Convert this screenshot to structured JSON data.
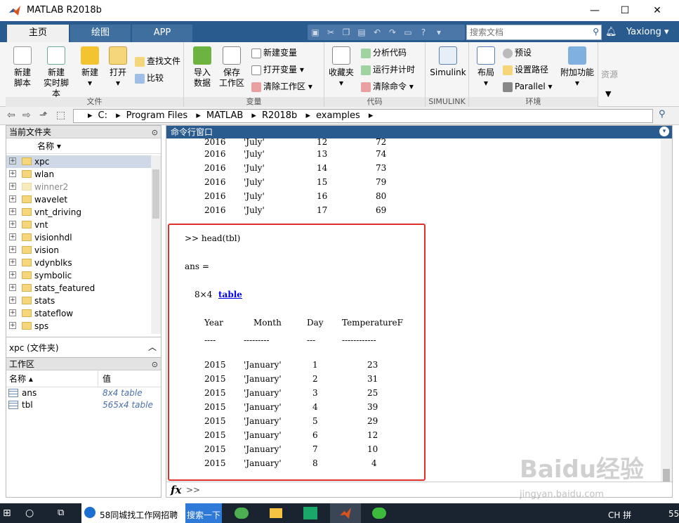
{
  "window": {
    "title": "MATLAB R2018b",
    "minimize": "—",
    "maximize": "☐",
    "close": "✕"
  },
  "tabs": [
    {
      "label": "主页"
    },
    {
      "label": "绘图"
    },
    {
      "label": "APP"
    }
  ],
  "search": {
    "placeholder": "搜索文档"
  },
  "user": {
    "name": "Yaxiong ▾"
  },
  "ribbon": {
    "file": {
      "group": "文件",
      "new_script": "新建\n脚本",
      "new_live": "新建\n实时脚本",
      "new": "新建",
      "open": "打开",
      "find_files": "查找文件",
      "compare": "比较"
    },
    "variable": {
      "group": "变量",
      "import": "导入\n数据",
      "save_ws": "保存\n工作区",
      "new_var": "新建变量",
      "open_var": "打开变量 ▾",
      "clear_ws": "清除工作区 ▾"
    },
    "code": {
      "group": "代码",
      "favorites": "收藏夹",
      "analyze": "分析代码",
      "run_time": "运行并计时",
      "clear_cmd": "清除命令 ▾"
    },
    "simulink": {
      "group": "SIMULINK",
      "simulink": "Simulink"
    },
    "env": {
      "group": "环境",
      "layout": "布局",
      "prefs": "预设",
      "set_path": "设置路径",
      "parallel": "Parallel ▾",
      "addons": "附加功能"
    },
    "resources": {
      "label": "资源"
    }
  },
  "path": {
    "segments": [
      "C:",
      "Program Files",
      "MATLAB",
      "R2018b",
      "examples"
    ]
  },
  "current_folder": {
    "title": "当前文件夹",
    "col_name": "名称 ▾",
    "items": [
      {
        "name": "xpc"
      },
      {
        "name": "wlan"
      },
      {
        "name": "winner2"
      },
      {
        "name": "wavelet"
      },
      {
        "name": "vnt_driving"
      },
      {
        "name": "vnt"
      },
      {
        "name": "visionhdl"
      },
      {
        "name": "vision"
      },
      {
        "name": "vdynblks"
      },
      {
        "name": "symbolic"
      },
      {
        "name": "stats_featured"
      },
      {
        "name": "stats"
      },
      {
        "name": "stateflow"
      },
      {
        "name": "sps"
      }
    ],
    "details": "xpc  (文件夹)"
  },
  "workspace": {
    "title": "工作区",
    "col_name": "名称 ▴",
    "col_value": "值",
    "vars": [
      {
        "name": "ans",
        "value": "8x4 table"
      },
      {
        "name": "tbl",
        "value": "565x4 table"
      }
    ]
  },
  "command_window": {
    "title": "命令行窗口",
    "top_rows": [
      {
        "year": "2016",
        "month": "'July'",
        "day": "12",
        "temp": "72"
      },
      {
        "year": "2016",
        "month": "'July'",
        "day": "13",
        "temp": "74"
      },
      {
        "year": "2016",
        "month": "'July'",
        "day": "14",
        "temp": "73"
      },
      {
        "year": "2016",
        "month": "'July'",
        "day": "15",
        "temp": "79"
      },
      {
        "year": "2016",
        "month": "'July'",
        "day": "16",
        "temp": "80"
      },
      {
        "year": "2016",
        "month": "'July'",
        "day": "17",
        "temp": "69"
      }
    ],
    "command": ">> head(tbl)",
    "ans_label": "ans =",
    "size_text": "8×4",
    "table_link": "table",
    "headers": {
      "year": "Year",
      "month": "Month",
      "day": "Day",
      "temp": "TemperatureF"
    },
    "separators": {
      "year": "----",
      "month": "---------",
      "day": "---",
      "temp": "------------"
    },
    "rows": [
      {
        "year": "2015",
        "month": "'January'",
        "day": "1",
        "temp": "23"
      },
      {
        "year": "2015",
        "month": "'January'",
        "day": "2",
        "temp": "31"
      },
      {
        "year": "2015",
        "month": "'January'",
        "day": "3",
        "temp": "25"
      },
      {
        "year": "2015",
        "month": "'January'",
        "day": "4",
        "temp": "39"
      },
      {
        "year": "2015",
        "month": "'January'",
        "day": "5",
        "temp": "29"
      },
      {
        "year": "2015",
        "month": "'January'",
        "day": "6",
        "temp": "12"
      },
      {
        "year": "2015",
        "month": "'January'",
        "day": "7",
        "temp": "10"
      },
      {
        "year": "2015",
        "month": "'January'",
        "day": "8",
        "temp": "4"
      }
    ],
    "prompt": ">>",
    "fx": "fx"
  },
  "taskbar": {
    "app1": "58同城找工作网招聘",
    "app1_action": "搜索一下",
    "ime": "CH 拼",
    "clock": "55"
  },
  "watermark": {
    "main": "Baidu经验",
    "sub": "jingyan.baidu.com"
  },
  "colors": {
    "accent": "#2a5b8e",
    "highlight_box": "#e0302b",
    "link": "#0000ee"
  }
}
